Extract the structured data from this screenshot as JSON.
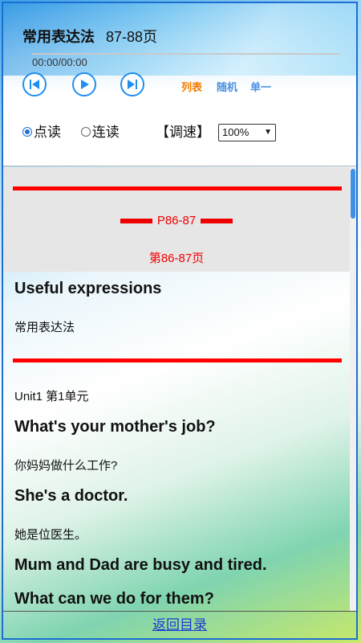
{
  "header": {
    "title": "常用表达法",
    "pages": "87-88页",
    "time": "00:00/00:00",
    "progress_fraction": 0,
    "modes": {
      "list": "列表",
      "random": "随机",
      "single": "单一"
    },
    "mode_colors": {
      "list": "#f57c00",
      "random": "#4a90e2",
      "single": "#4a90e2"
    },
    "read_options": [
      "点读",
      "连读"
    ],
    "read_selected": "点读",
    "speed_label": "【调速】",
    "speed_value": "100%"
  },
  "content": {
    "page_label": "P86-87",
    "page_label_cn": "第86-87页",
    "section_en": "Useful expressions",
    "section_zh": "常用表达法",
    "unit": "Unit1 第1单元",
    "lines": [
      {
        "en": "What's your mother's job?",
        "zh": "你妈妈做什么工作?"
      },
      {
        "en": "She's a doctor.",
        "zh": "她是位医生。"
      },
      {
        "en": "Mum and Dad are busy and tired.",
        "zh": ""
      },
      {
        "en": "What can we do for them?",
        "zh": ""
      }
    ]
  },
  "footer": {
    "back_link": "返回目录"
  },
  "colors": {
    "accent": "#1e8ff0",
    "red": "#ff0000"
  }
}
